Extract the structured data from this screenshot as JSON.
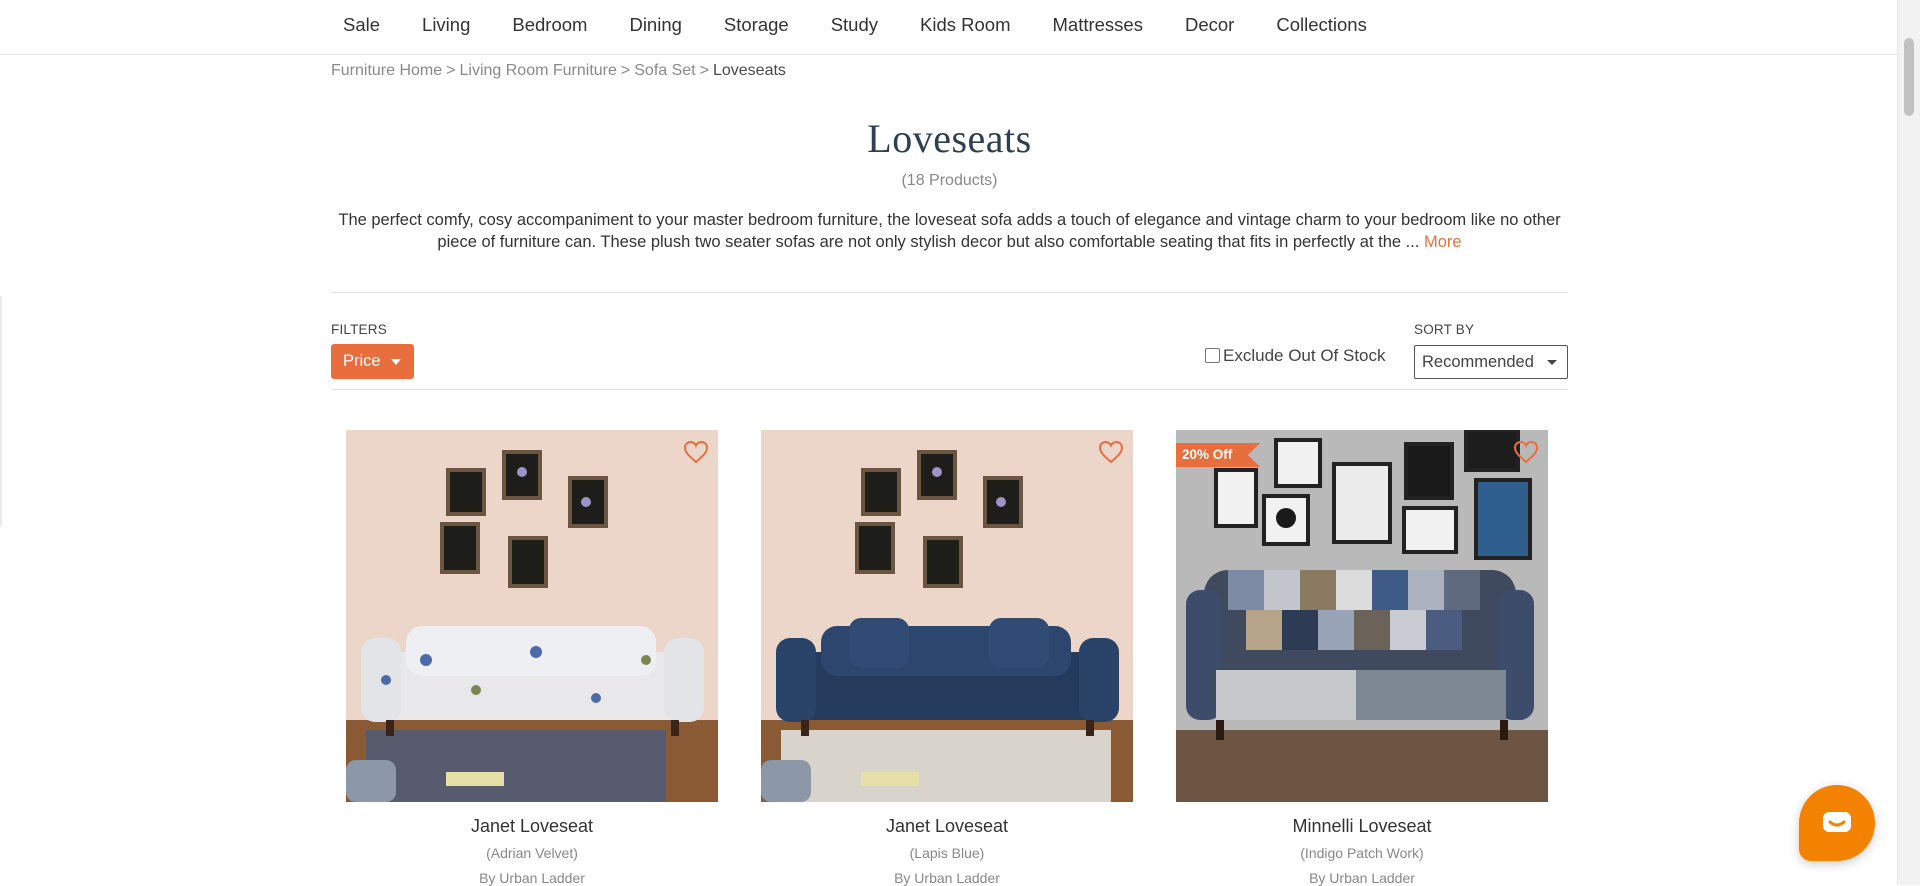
{
  "nav": {
    "items": [
      "Sale",
      "Living",
      "Bedroom",
      "Dining",
      "Storage",
      "Study",
      "Kids Room",
      "Mattresses",
      "Decor",
      "Collections"
    ]
  },
  "breadcrumb": {
    "items": [
      "Furniture Home",
      "Living Room Furniture",
      "Sofa Set"
    ],
    "separator": ">",
    "current": "Loveseats"
  },
  "page": {
    "title": "Loveseats",
    "count": "(18 Products)",
    "description": "The perfect comfy, cosy accompaniment to your master bedroom furniture, the loveseat sofa adds a touch of elegance and vintage charm to your bedroom like no other piece of furniture can. These plush two seater sofas are not only stylish decor but also comfortable seating that fits in perfectly at the ...",
    "more_label": "More"
  },
  "filters": {
    "label": "FILTERS",
    "price_label": "Price",
    "exclude_out_of_stock_label": "Exclude Out Of Stock",
    "exclude_out_of_stock_checked": false,
    "sort_label": "SORT BY",
    "sort_value": "Recommended"
  },
  "products": [
    {
      "name": "Janet Loveseat",
      "variant": "(Adrian Velvet)",
      "brand": "By Urban Ladder",
      "badge": "",
      "sofa_color": "floral-white"
    },
    {
      "name": "Janet Loveseat",
      "variant": "(Lapis Blue)",
      "brand": "By Urban Ladder",
      "badge": "",
      "sofa_color": "navy-blue"
    },
    {
      "name": "Minnelli Loveseat",
      "variant": "(Indigo Patch Work)",
      "brand": "By Urban Ladder",
      "badge": "20% Off",
      "sofa_color": "indigo-patchwork"
    }
  ],
  "colors": {
    "accent": "#e86f3d",
    "title": "#2e3f51",
    "chat": "#f28200"
  },
  "icons": [
    "heart-icon",
    "chat-icon",
    "caret-down-icon",
    "checkbox-icon"
  ]
}
